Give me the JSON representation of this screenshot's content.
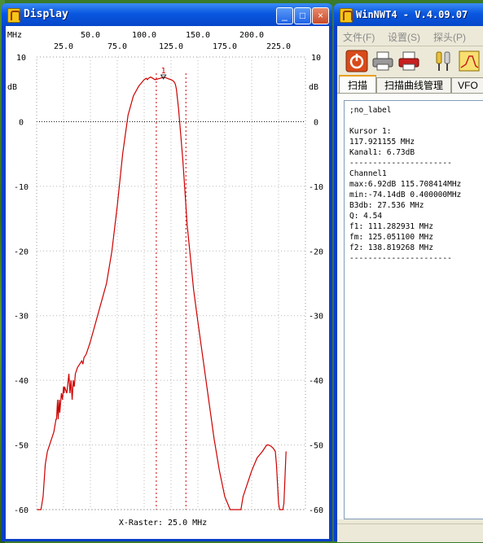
{
  "display_window": {
    "title": "Display",
    "controls": {
      "minimize": "_",
      "maximize": "□",
      "close": "×"
    }
  },
  "chart_data": {
    "type": "line",
    "x_unit_label": "MHz",
    "y_unit_label": "dB",
    "xlim": [
      0,
      250
    ],
    "ylim": [
      -60,
      10
    ],
    "top_ticks": [
      "50.0",
      "100.0",
      "150.0",
      "200.0"
    ],
    "bottom_ticks": [
      "25.0",
      "75.0",
      "125.0",
      "175.0",
      "225.0"
    ],
    "y_ticks": [
      "10",
      "0",
      "-10",
      "-20",
      "-30",
      "-40",
      "-50",
      "-60"
    ],
    "footer": "X-Raster: 25.0 MHz",
    "marker_label": "1",
    "grid": true,
    "cursor_lines_mhz": [
      111.28,
      138.82
    ],
    "series": [
      {
        "color": "#cc0000",
        "x": [
          0.4,
          2,
          4,
          6,
          8,
          10,
          12,
          14,
          16,
          18,
          18.5,
          19.5,
          20,
          21,
          21.5,
          22.5,
          23,
          24,
          25,
          25.5,
          26,
          28,
          30,
          31,
          32,
          33,
          34,
          35,
          36,
          38,
          40,
          42,
          43,
          44,
          46,
          48,
          50,
          55,
          60,
          65,
          70,
          75,
          80,
          85,
          90,
          95,
          100,
          102,
          103,
          104,
          106,
          108,
          110,
          115,
          118,
          120,
          123,
          125,
          127,
          128,
          129,
          130,
          132,
          134,
          136,
          138,
          140,
          143,
          146,
          150,
          155,
          160,
          165,
          170,
          175,
          180,
          185,
          188,
          190,
          192,
          196,
          200,
          205,
          210,
          212,
          214,
          216,
          218,
          220,
          222,
          223,
          224,
          225,
          226,
          228,
          229,
          230,
          231,
          232
        ],
        "y": [
          -60,
          -60,
          -60,
          -58,
          -53,
          -51,
          -50,
          -49,
          -48,
          -46,
          -46,
          -43,
          -46,
          -43,
          -45,
          -43,
          -42,
          -43,
          -41,
          -42,
          -41,
          -42,
          -39,
          -42,
          -40,
          -43,
          -40,
          -41,
          -39,
          -38,
          -37.5,
          -37,
          -37.5,
          -36.5,
          -36,
          -35,
          -34,
          -31,
          -28,
          -25,
          -20,
          -13,
          -5,
          1,
          4,
          5.5,
          6.5,
          6.7,
          6.5,
          6.7,
          6.9,
          6.7,
          6.5,
          6.7,
          6.9,
          6.8,
          6.6,
          6.5,
          6.3,
          6.1,
          5.8,
          5,
          2,
          -2,
          -6,
          -11,
          -16,
          -21,
          -26,
          -31,
          -37,
          -43,
          -49,
          -54,
          -58,
          -60,
          -60,
          -60,
          -60,
          -58,
          -56,
          -54,
          -52,
          -51,
          -50.5,
          -50,
          -50,
          -50.2,
          -50.5,
          -51,
          -53,
          -56,
          -59,
          -60,
          -60,
          -60,
          -59,
          -55,
          -51
        ]
      }
    ]
  },
  "nwt_window": {
    "title": "WinNWT4 - V.4.09.07",
    "menus": [
      "文件(F)",
      "设置(S)",
      "探头(P)"
    ],
    "tabs": [
      "扫描",
      "扫描曲线管理",
      "VFO"
    ],
    "info_lines": [
      ";no_label",
      "",
      "Kursor 1:",
      "117.921155 MHz",
      "Kanal1: 6.73dB",
      "----------------------",
      "Channel1",
      "max:6.92dB 115.708414MHz",
      "min:-74.14dB 0.400000MHz",
      "B3db: 27.536 MHz",
      "Q: 4.54",
      "f1: 111.282931 MHz",
      "fm: 125.051100 MHz",
      "f2: 138.819268 MHz",
      "----------------------"
    ]
  },
  "icons": [
    "app-icon",
    "power-icon",
    "printer-icon",
    "printer-red-icon",
    "probe-icon",
    "graph-icon",
    "minimize-icon",
    "maximize-icon",
    "close-icon"
  ]
}
